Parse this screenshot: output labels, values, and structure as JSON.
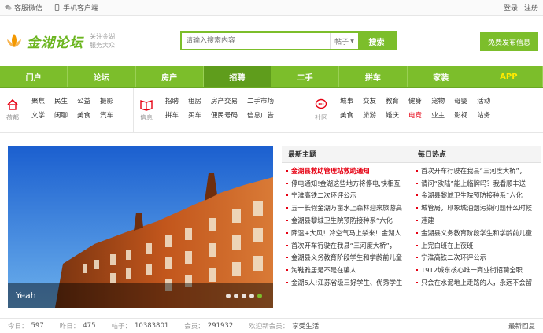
{
  "topbar": {
    "weixin": "客服微信",
    "mobile": "手机客户端",
    "login": "登录",
    "register": "注册"
  },
  "header": {
    "logo_text": "金湖论坛",
    "slogan_line1": "关注金湖",
    "slogan_line2": "服务大众",
    "search_placeholder": "请输入搜索内容",
    "search_select": "帖子",
    "search_button": "搜索",
    "post_button": "免费发布信息"
  },
  "nav": [
    "门户",
    "论坛",
    "房产",
    "招聘",
    "二手",
    "拼车",
    "家装",
    "APP"
  ],
  "nav_active": 3,
  "subnav": [
    {
      "icon_label": "荷都",
      "links": [
        "聚焦",
        "文学",
        "民生",
        "闲聊",
        "公益",
        "美食",
        "摄影",
        "汽车"
      ]
    },
    {
      "icon_label": "信息",
      "links": [
        "招聘",
        "拼车",
        "租房",
        "买车",
        "房产交易",
        "便民号码",
        "二手市场",
        "信息广告"
      ]
    },
    {
      "icon_label": "社区",
      "links": [
        "城事",
        "美食",
        "交友",
        "旅游",
        "教育",
        "婚庆",
        "健身",
        "电竞",
        "宠物",
        "业主",
        "母婴",
        "影视",
        "活动",
        "站务"
      ]
    }
  ],
  "slider": {
    "caption": "Yeah"
  },
  "latest": {
    "title": "最新主题",
    "items": [
      "金湖县救助管理站救助通知",
      "停电通知!金湖这些地方将停电,快相互",
      "宁淮高铁二次环评公示",
      "五一长假金湖万亩水上森林迎来旅游高",
      "金湖县黎城卫生院预防接种系“六化",
      "降温+大风！冷空气马上杀来！金湖人",
      "首次开车行驶在我县“三河度大桥”，",
      "金湖县义务教育阶段学生和学龄前儿童",
      "淘鞋雅居是不是在骗人",
      "金湖5人!江苏省级三好学生、优秀学生"
    ]
  },
  "hot": {
    "title": "每日热点",
    "items": [
      "首次开车行驶在我县“三河度大桥”，",
      "请问“欧陆”能上临牌吗？我看顺丰送",
      "金湖县黎城卫生院预防接种系“六化",
      "城管局，印象城油烟污染问题什么时候",
      "违建",
      "金湖县义务教育阶段学生和学龄前儿童",
      "上完白班在上夜班",
      "宁淮高铁二次环评公示",
      "1912城东核心唯一商业街招聘全职",
      "只会在水泥地上走路的人，永远不会留"
    ]
  },
  "stats": {
    "today_label": "今日：",
    "today": "597",
    "yesterday_label": "昨日：",
    "yesterday": "475",
    "posts_label": "帖子：",
    "posts": "10383801",
    "members_label": "会员：",
    "members": "291932",
    "welcome_label": "欢迎新会员：",
    "newest_member": "享受生活",
    "latest_reply": "最新回复"
  },
  "colors": {
    "brand_green": "#7cbe2b",
    "nav_active": "#5f9d1c",
    "highlight_red": "#e60012"
  }
}
